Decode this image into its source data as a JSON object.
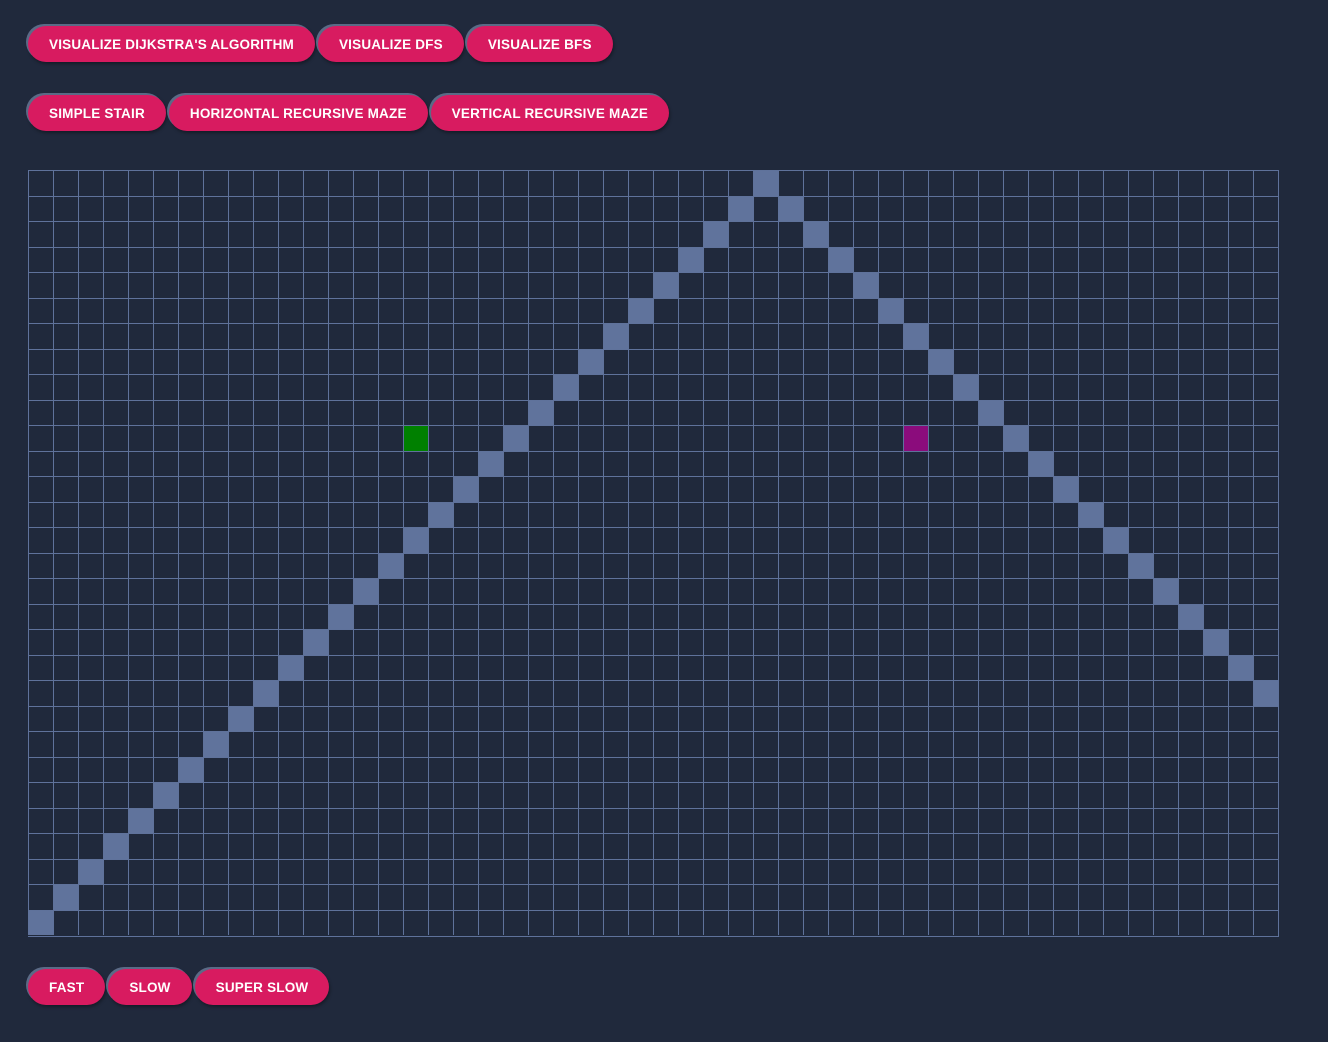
{
  "algorithm_buttons": [
    {
      "label": "VISUALIZE DIJKSTRA'S ALGORITHM",
      "name": "visualize-dijkstra-button"
    },
    {
      "label": "VISUALIZE DFS",
      "name": "visualize-dfs-button"
    },
    {
      "label": "VISUALIZE BFS",
      "name": "visualize-bfs-button"
    }
  ],
  "maze_buttons": [
    {
      "label": "SIMPLE STAIR",
      "name": "simple-stair-button"
    },
    {
      "label": "HORIZONTAL RECURSIVE MAZE",
      "name": "horizontal-recursive-maze-button"
    },
    {
      "label": "VERTICAL RECURSIVE MAZE",
      "name": "vertical-recursive-maze-button"
    }
  ],
  "speed_buttons": [
    {
      "label": "FAST",
      "name": "speed-fast-button"
    },
    {
      "label": "SLOW",
      "name": "speed-slow-button"
    },
    {
      "label": "SUPER SLOW",
      "name": "speed-super-slow-button"
    }
  ],
  "grid": {
    "rows": 30,
    "cols": 50,
    "start": {
      "row": 10,
      "col": 15
    },
    "target": {
      "row": 10,
      "col": 35
    },
    "walls": [
      [
        29,
        0
      ],
      [
        28,
        1
      ],
      [
        27,
        2
      ],
      [
        26,
        3
      ],
      [
        25,
        4
      ],
      [
        24,
        5
      ],
      [
        23,
        6
      ],
      [
        22,
        7
      ],
      [
        21,
        8
      ],
      [
        20,
        9
      ],
      [
        19,
        10
      ],
      [
        18,
        11
      ],
      [
        17,
        12
      ],
      [
        16,
        13
      ],
      [
        15,
        14
      ],
      [
        14,
        15
      ],
      [
        13,
        16
      ],
      [
        12,
        17
      ],
      [
        11,
        18
      ],
      [
        10,
        19
      ],
      [
        9,
        20
      ],
      [
        8,
        21
      ],
      [
        7,
        22
      ],
      [
        6,
        23
      ],
      [
        5,
        24
      ],
      [
        4,
        25
      ],
      [
        3,
        26
      ],
      [
        2,
        27
      ],
      [
        1,
        28
      ],
      [
        0,
        29
      ],
      [
        1,
        30
      ],
      [
        2,
        31
      ],
      [
        3,
        32
      ],
      [
        4,
        33
      ],
      [
        5,
        34
      ],
      [
        6,
        35
      ],
      [
        7,
        36
      ],
      [
        8,
        37
      ],
      [
        9,
        38
      ],
      [
        10,
        39
      ],
      [
        11,
        40
      ],
      [
        12,
        41
      ],
      [
        13,
        42
      ],
      [
        14,
        43
      ],
      [
        15,
        44
      ],
      [
        16,
        45
      ],
      [
        17,
        46
      ],
      [
        18,
        47
      ],
      [
        19,
        48
      ],
      [
        20,
        49
      ]
    ]
  },
  "colors": {
    "background": "#20293c",
    "button": "#d81b60",
    "wall": "#60739c",
    "grid_line": "#5f729b",
    "start_node": "#008000",
    "target_node": "#8b0c7c"
  }
}
